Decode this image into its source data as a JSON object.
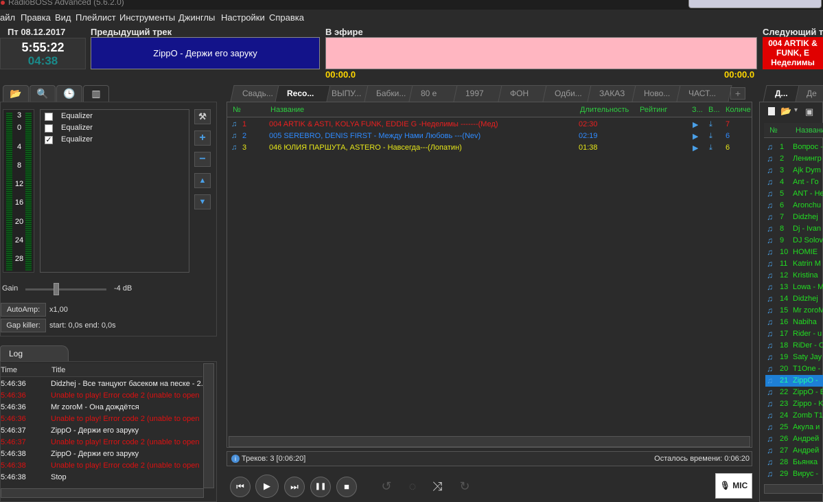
{
  "window": {
    "title": "RadioBOSS Advanced (5.6.2.0)"
  },
  "menu": [
    "айл",
    "Правка",
    "Вид",
    "Плейлист",
    "Инструменты",
    "Джинглы",
    "Настройки",
    "Справка"
  ],
  "header": {
    "date": "Пт 08.12.2017",
    "clock": "5:55:22",
    "timer": "04:38",
    "prev_label": "Предыдущий трек",
    "prev_track": "ZippO - Держи его заруку",
    "air_label": "В эфире",
    "air_time_left": "00:00.0",
    "air_time_right": "00:00.0",
    "next_label": "Следующий тр",
    "next_track_lines": [
      "004 ARTIK &",
      "FUNK, E",
      "Неделимы"
    ]
  },
  "left_tabs": [
    "folder",
    "search",
    "clock",
    "equalizer"
  ],
  "meter_ticks": [
    "3",
    "0",
    "4",
    "8",
    "12",
    "16",
    "20",
    "24",
    "28"
  ],
  "equalizers": [
    {
      "label": "Equalizer",
      "checked": false,
      "mark": ""
    },
    {
      "label": "Equalizer",
      "checked": false,
      "mark": ""
    },
    {
      "label": "Equalizer",
      "checked": true,
      "mark": "✓"
    }
  ],
  "gain": {
    "label": "Gain",
    "value": "-4 dB",
    "level": 0.38
  },
  "autoamp": {
    "button": "AutoAmp:",
    "value": "x1,00"
  },
  "gapkiller": {
    "button": "Gap killer:",
    "value": "start: 0,0s end: 0,0s"
  },
  "log": {
    "tab": "Log",
    "col_time": "Time",
    "col_title": "Title",
    "rows": [
      {
        "time": "5:46:36",
        "title": "Didzhej - Все танцуют басеком на песке - 2.",
        "error": false
      },
      {
        "time": "5:46:36",
        "title": "Unable to play! Error code 2 (unable to open",
        "error": true
      },
      {
        "time": "5:46:36",
        "title": "Mr zoroM - Она дождётся",
        "error": false
      },
      {
        "time": "5:46:36",
        "title": "Unable to play! Error code 2 (unable to open",
        "error": true
      },
      {
        "time": "5:46:37",
        "title": "ZippO - Держи его заруку",
        "error": false
      },
      {
        "time": "5:46:37",
        "title": "Unable to play! Error code 2 (unable to open",
        "error": true
      },
      {
        "time": "5:46:38",
        "title": "ZippO - Держи его заруку",
        "error": false
      },
      {
        "time": "5:46:38",
        "title": "Unable to play! Error code 2 (unable to open",
        "error": true
      },
      {
        "time": "5:46:38",
        "title": "Stop",
        "error": false
      }
    ]
  },
  "playlist_tabs": [
    "Свадь...",
    "Reco...",
    "ВЫПУ...",
    "Бабки...",
    "80 е",
    "1997",
    "ФОН",
    "Одби...",
    "ЗАКАЗ",
    "Ново...",
    "ЧАСТ..."
  ],
  "playlist": {
    "columns": {
      "num": "№",
      "title": "Название",
      "duration": "Длительность",
      "rating": "Рейтинг",
      "c1": "З...",
      "c2": "В...",
      "count": "Количе"
    },
    "rows": [
      {
        "num": "1",
        "title": "004 ARTIK & ASTI, KOLYA FUNK, EDDIE G -Неделимы -------(Мед)",
        "duration": "02:30",
        "count": "7",
        "color": "#e82020"
      },
      {
        "num": "2",
        "title": "005 SEREBRO, DENIS FIRST - Между Нами Любовь ---(Nev)",
        "duration": "02:19",
        "count": "6",
        "color": "#2f8bff"
      },
      {
        "num": "3",
        "title": "046 ЮЛИЯ ПАРШУТА, ASTERO - Навсегда---(Лопатин)",
        "duration": "01:38",
        "count": "6",
        "color": "#e6e619"
      }
    ],
    "status_left": "Треков: 3 [0:06:20]",
    "status_right": "Осталось времени: 0:06:20"
  },
  "transport": {
    "prev": "⏮",
    "play": "▶",
    "next": "⏭",
    "pause": "❚❚",
    "stop": "■",
    "mic": "MIC"
  },
  "right_tabs": [
    "Д...",
    "Де"
  ],
  "right_list": {
    "col_num": "№",
    "col_title": "Названи",
    "rows": [
      {
        "n": "1",
        "t": "Вопрос -"
      },
      {
        "n": "2",
        "t": "Ленингр"
      },
      {
        "n": "3",
        "t": "Ajk Dym"
      },
      {
        "n": "4",
        "t": "Ant - Го"
      },
      {
        "n": "5",
        "t": "ANT - He"
      },
      {
        "n": "6",
        "t": "Aronchu"
      },
      {
        "n": "7",
        "t": "Didzhej"
      },
      {
        "n": "8",
        "t": "Dj - Ivan"
      },
      {
        "n": "9",
        "t": "DJ Solov"
      },
      {
        "n": "10",
        "t": "HOMIE"
      },
      {
        "n": "11",
        "t": "Katrin M"
      },
      {
        "n": "12",
        "t": "Kristina"
      },
      {
        "n": "13",
        "t": "Lowa - M"
      },
      {
        "n": "14",
        "t": "Didzhej"
      },
      {
        "n": "15",
        "t": "Mr zoroM"
      },
      {
        "n": "16",
        "t": "Nabiha"
      },
      {
        "n": "17",
        "t": "Rider - u"
      },
      {
        "n": "18",
        "t": "RiDer - C"
      },
      {
        "n": "19",
        "t": "Saty Jay"
      },
      {
        "n": "20",
        "t": "T1One -"
      },
      {
        "n": "21",
        "t": "ZippO -"
      },
      {
        "n": "22",
        "t": "ZippO - E"
      },
      {
        "n": "23",
        "t": "Zippo - K"
      },
      {
        "n": "24",
        "t": "Zomb T1"
      },
      {
        "n": "25",
        "t": "Акула и"
      },
      {
        "n": "26",
        "t": "Андрей"
      },
      {
        "n": "27",
        "t": "Андрей"
      },
      {
        "n": "28",
        "t": "Бьянка"
      },
      {
        "n": "29",
        "t": "Вирус -"
      }
    ],
    "selected_index": 20
  }
}
